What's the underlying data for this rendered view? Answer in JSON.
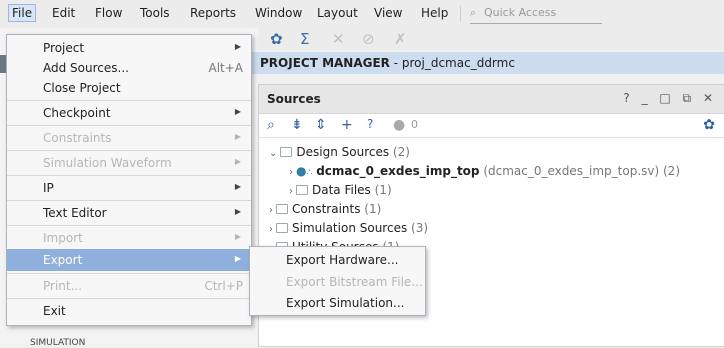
{
  "menubar": {
    "items": [
      "File",
      "Edit",
      "Flow",
      "Tools",
      "Reports",
      "Window",
      "Layout",
      "View",
      "Help"
    ],
    "quick_access_placeholder": "Quick Access"
  },
  "toolbar": {
    "icons": [
      "gear-icon",
      "sigma-icon",
      "cross-tool-icon",
      "slash-tool-icon",
      "x-tool-icon"
    ]
  },
  "project_manager": {
    "prefix": "PROJECT MANAGER",
    "project": " - proj_dcmac_ddrmc"
  },
  "sources": {
    "title": "Sources",
    "controls": "? _ □ ⧉ ✕",
    "count": "0",
    "tree": [
      {
        "label": "Design Sources",
        "count": " (2)"
      },
      {
        "label": "dcmac_0_exdes_imp_top",
        "detail": " (dcmac_0_exdes_imp_top.sv) (2)"
      },
      {
        "label": "Data Files",
        "count": " (1)"
      },
      {
        "label": "Constraints",
        "count": " (1)"
      },
      {
        "label": "Simulation Sources",
        "count": " (3)"
      },
      {
        "label": "Utility Sources",
        "count": " (1)"
      }
    ]
  },
  "left_bottom_label": "SIMULATION",
  "file_menu": {
    "items": [
      {
        "label": "Project",
        "accel": "",
        "submenu": true,
        "disabled": false
      },
      {
        "label": "Add Sources...",
        "accel": "Alt+A",
        "submenu": false,
        "disabled": false
      },
      {
        "label": "Close Project",
        "accel": "",
        "submenu": false,
        "disabled": false
      },
      {
        "label": "Checkpoint",
        "accel": "",
        "submenu": true,
        "disabled": false
      },
      {
        "label": "Constraints",
        "accel": "",
        "submenu": true,
        "disabled": true
      },
      {
        "label": "Simulation Waveform",
        "accel": "",
        "submenu": true,
        "disabled": true
      },
      {
        "label": "IP",
        "accel": "",
        "submenu": true,
        "disabled": false
      },
      {
        "label": "Text Editor",
        "accel": "",
        "submenu": true,
        "disabled": false
      },
      {
        "label": "Import",
        "accel": "",
        "submenu": true,
        "disabled": true
      },
      {
        "label": "Export",
        "accel": "",
        "submenu": true,
        "disabled": false
      },
      {
        "label": "Print...",
        "accel": "Ctrl+P",
        "submenu": false,
        "disabled": true
      },
      {
        "label": "Exit",
        "accel": "",
        "submenu": false,
        "disabled": false
      }
    ]
  },
  "export_submenu": {
    "items": [
      {
        "label": "Export Hardware...",
        "disabled": false
      },
      {
        "label": "Export Bitstream File...",
        "disabled": true
      },
      {
        "label": "Export Simulation...",
        "disabled": false
      }
    ]
  },
  "colors": {
    "highlight": "#8fb0dc",
    "accent": "#2f5f9e",
    "pm_bar": "#cddcef"
  }
}
